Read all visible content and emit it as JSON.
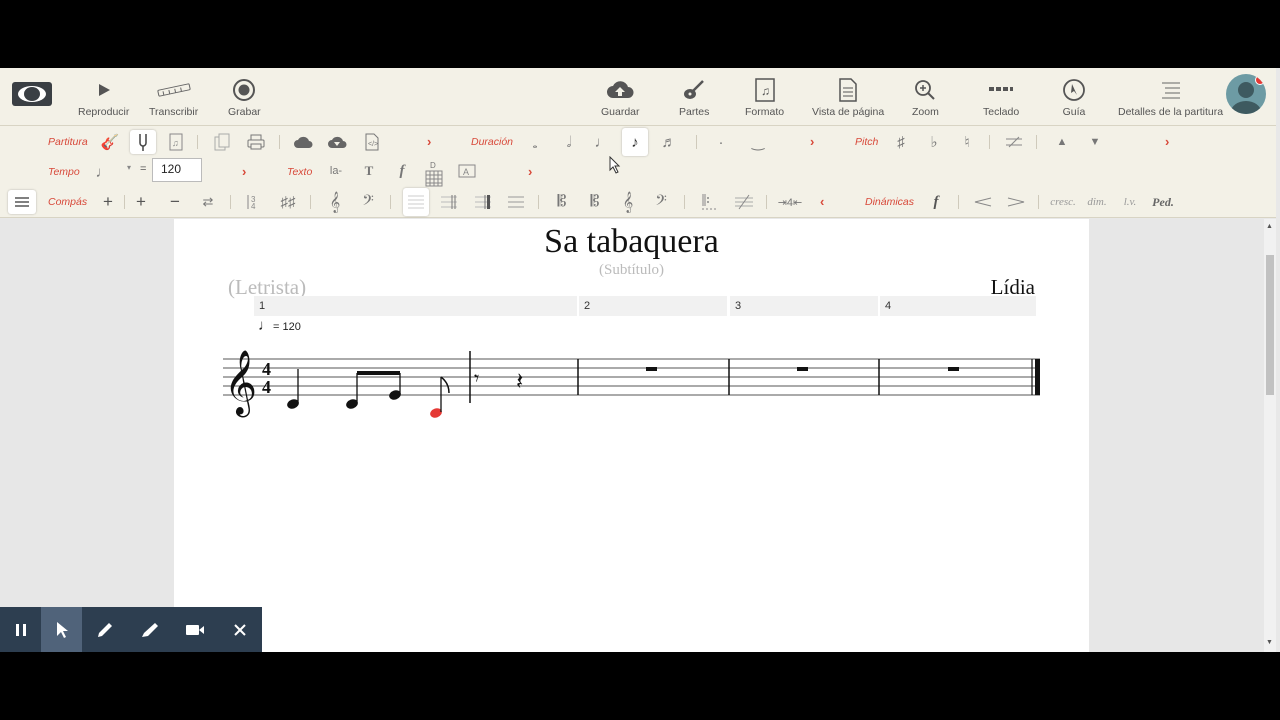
{
  "top_toolbar": {
    "buttons": [
      {
        "label": "Reproducir",
        "icon": "play-icon"
      },
      {
        "label": "Transcribir",
        "icon": "keyboard-icon"
      },
      {
        "label": "Grabar",
        "icon": "record-icon"
      },
      {
        "label": "Guardar",
        "icon": "cloud-upload-icon"
      },
      {
        "label": "Partes",
        "icon": "guitar-icon"
      },
      {
        "label": "Formato",
        "icon": "score-format-icon"
      },
      {
        "label": "Vista de página",
        "icon": "page-view-icon"
      },
      {
        "label": "Zoom",
        "icon": "zoom-icon"
      },
      {
        "label": "Teclado",
        "icon": "keyboard-dots-icon"
      },
      {
        "label": "Guía",
        "icon": "compass-icon"
      },
      {
        "label": "Detalles de la partitura",
        "icon": "list-icon"
      }
    ]
  },
  "sections": {
    "partitura": "Partitura",
    "duracion": "Duración",
    "pitch": "Pitch",
    "tempo": "Tempo",
    "texto": "Texto",
    "compas": "Compás",
    "dinamicas": "Dinámicas"
  },
  "tempo": {
    "equals": "=",
    "value": "120"
  },
  "text_tools": {
    "lyric": "la-",
    "text": "T",
    "dynamic": "f",
    "chord_label": "D"
  },
  "dynamics_tools": {
    "forte": "f",
    "cresc": "cresc.",
    "dim": "dim.",
    "lv": "l.v.",
    "ped": "Ped."
  },
  "score": {
    "title": "Sa tabaquera",
    "subtitle": "(Subtítulo)",
    "lyricist": "(Letrista)",
    "composer": "Lídia",
    "tempo_mark": "= 120",
    "time_signature": "4/4",
    "measures": [
      "1",
      "2",
      "3",
      "4"
    ]
  },
  "colors": {
    "accent": "#d8493a",
    "toolbar_bg": "#f3f1e7",
    "selected_note": "#e53935",
    "rec_bar": "#2d3e50"
  }
}
